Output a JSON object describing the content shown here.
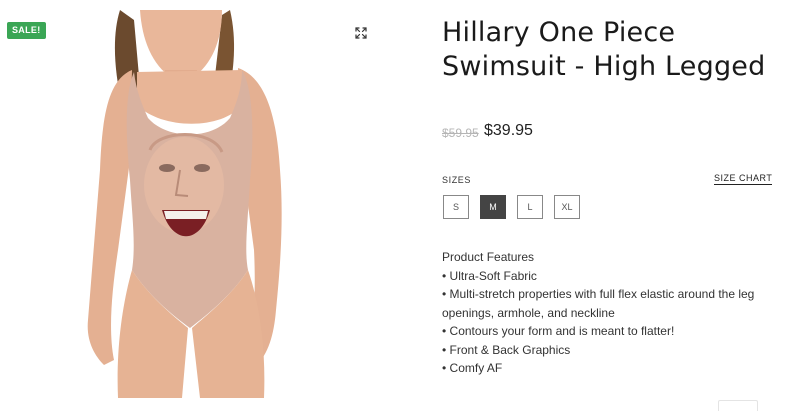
{
  "badge": {
    "label": "SALE!",
    "color": "#3aa655"
  },
  "gallery": {
    "zoom_icon": "expand-icon"
  },
  "product": {
    "title": "Hillary One Piece Swimsuit - High Legged",
    "old_price": "$59.95",
    "price": "$39.95"
  },
  "sizes": {
    "label": "SIZES",
    "chart_label": "SIZE CHART",
    "options": [
      "S",
      "M",
      "L",
      "XL"
    ],
    "selected": "M"
  },
  "features": {
    "title": "Product Features",
    "items": [
      "Ultra-Soft Fabric",
      "Multi-stretch properties with full flex elastic around the leg openings, armhole, and neckline",
      "Contours your form and is meant to flatter!",
      "Front & Back Graphics",
      "Comfy AF"
    ]
  }
}
